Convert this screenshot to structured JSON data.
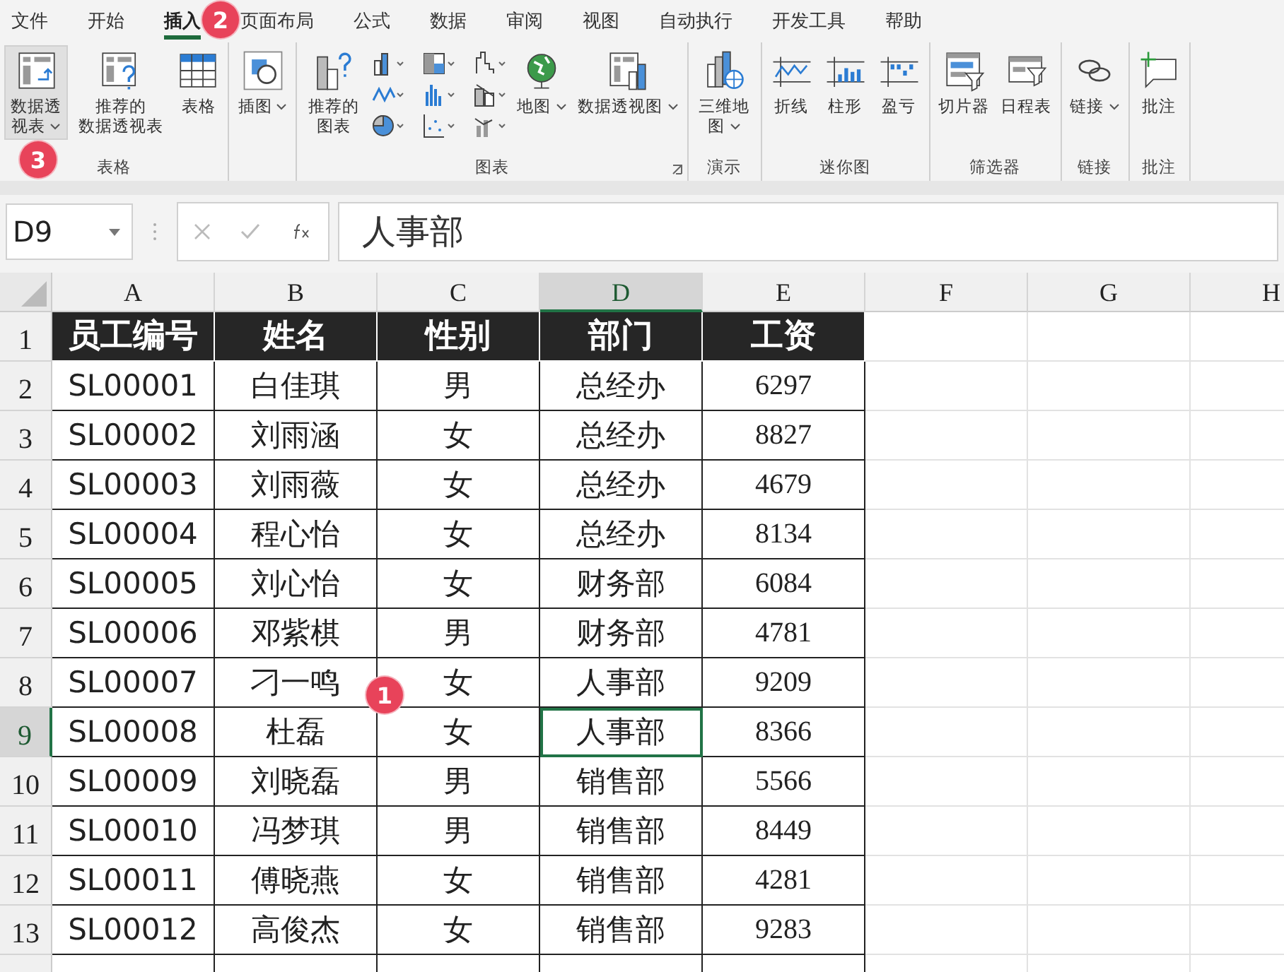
{
  "menu_tabs": [
    {
      "label": "文件",
      "selected": false
    },
    {
      "label": "开始",
      "selected": false
    },
    {
      "label": "插入",
      "selected": true
    },
    {
      "label": "页面布局",
      "selected": false
    },
    {
      "label": "公式",
      "selected": false
    },
    {
      "label": "数据",
      "selected": false
    },
    {
      "label": "审阅",
      "selected": false
    },
    {
      "label": "视图",
      "selected": false
    },
    {
      "label": "自动执行",
      "selected": false
    },
    {
      "label": "开发工具",
      "selected": false
    },
    {
      "label": "帮助",
      "selected": false
    }
  ],
  "ribbon_groups": [
    {
      "label": "表格",
      "launcher": false,
      "buttons": [
        {
          "label": "数据透视表",
          "dropdown": true,
          "selected": true
        },
        {
          "label": "推荐的数据透视表",
          "dropdown": false,
          "selected": false
        },
        {
          "label": "表格",
          "dropdown": false,
          "selected": false
        }
      ]
    },
    {
      "launcher": false,
      "buttons": [
        {
          "label": "插图",
          "dropdown": true,
          "selected": false
        }
      ]
    },
    {
      "label": "图表",
      "launcher": true,
      "buttons": [
        {
          "label": "推荐的图表",
          "dropdown": false,
          "selected": false
        },
        {
          "label": "地图",
          "dropdown": true,
          "selected": false
        },
        {
          "label": "数据透视图",
          "dropdown": true,
          "selected": false
        }
      ]
    },
    {
      "label": "演示",
      "launcher": false,
      "buttons": [
        {
          "label": "三维地图",
          "dropdown": true,
          "selected": false
        }
      ]
    },
    {
      "label": "迷你图",
      "launcher": false,
      "buttons": [
        {
          "label": "折线",
          "dropdown": false,
          "selected": false
        },
        {
          "label": "柱形",
          "dropdown": false,
          "selected": false
        },
        {
          "label": "盈亏",
          "dropdown": false,
          "selected": false
        }
      ]
    },
    {
      "label": "筛选器",
      "launcher": false,
      "buttons": [
        {
          "label": "切片器",
          "dropdown": false,
          "selected": false
        },
        {
          "label": "日程表",
          "dropdown": false,
          "selected": false
        }
      ]
    },
    {
      "label": "链接",
      "launcher": false,
      "buttons": [
        {
          "label": "链接",
          "dropdown": true,
          "selected": false
        }
      ]
    },
    {
      "label": "批注",
      "launcher": false,
      "buttons": [
        {
          "label": "批注",
          "dropdown": false,
          "selected": false
        }
      ]
    }
  ],
  "name_box": "D9",
  "formula": "人事部",
  "columns": [
    {
      "label": "A",
      "selected": false
    },
    {
      "label": "B",
      "selected": false
    },
    {
      "label": "C",
      "selected": false
    },
    {
      "label": "D",
      "selected": true
    },
    {
      "label": "E",
      "selected": false
    },
    {
      "label": "F",
      "selected": false
    },
    {
      "label": "G",
      "selected": false
    },
    {
      "label": "H",
      "selected": false
    }
  ],
  "rows": [
    {
      "number": "1",
      "kind": "header",
      "selected": false,
      "cells": [
        "员工编号",
        "姓名",
        "性别",
        "部门",
        "工资"
      ]
    },
    {
      "number": "2",
      "kind": "data",
      "selected": false,
      "cells": [
        "SL00001",
        "白佳琪",
        "男",
        "总经办",
        "6297"
      ]
    },
    {
      "number": "3",
      "kind": "data",
      "selected": false,
      "cells": [
        "SL00002",
        "刘雨涵",
        "女",
        "总经办",
        "8827"
      ]
    },
    {
      "number": "4",
      "kind": "data",
      "selected": false,
      "cells": [
        "SL00003",
        "刘雨薇",
        "女",
        "总经办",
        "4679"
      ]
    },
    {
      "number": "5",
      "kind": "data",
      "selected": false,
      "cells": [
        "SL00004",
        "程心怡",
        "女",
        "总经办",
        "8134"
      ]
    },
    {
      "number": "6",
      "kind": "data",
      "selected": false,
      "cells": [
        "SL00005",
        "刘心怡",
        "女",
        "财务部",
        "6084"
      ]
    },
    {
      "number": "7",
      "kind": "data",
      "selected": false,
      "cells": [
        "SL00006",
        "邓紫棋",
        "男",
        "财务部",
        "4781"
      ]
    },
    {
      "number": "8",
      "kind": "data",
      "selected": false,
      "cells": [
        "SL00007",
        "刁一鸣",
        "女",
        "人事部",
        "9209"
      ]
    },
    {
      "number": "9",
      "kind": "data",
      "selected": true,
      "cells": [
        "SL00008",
        "杜磊",
        "女",
        "人事部",
        "8366"
      ]
    },
    {
      "number": "10",
      "kind": "data",
      "selected": false,
      "cells": [
        "SL00009",
        "刘晓磊",
        "男",
        "销售部",
        "5566"
      ]
    },
    {
      "number": "11",
      "kind": "data",
      "selected": false,
      "cells": [
        "SL00010",
        "冯梦琪",
        "男",
        "销售部",
        "8449"
      ]
    },
    {
      "number": "12",
      "kind": "data",
      "selected": false,
      "cells": [
        "SL00011",
        "傅晓燕",
        "女",
        "销售部",
        "4281"
      ]
    },
    {
      "number": "13",
      "kind": "data",
      "selected": false,
      "cells": [
        "SL00012",
        "高俊杰",
        "女",
        "销售部",
        "9283"
      ]
    }
  ],
  "callouts": [
    {
      "text": "1"
    },
    {
      "text": "2"
    },
    {
      "text": "3"
    }
  ]
}
